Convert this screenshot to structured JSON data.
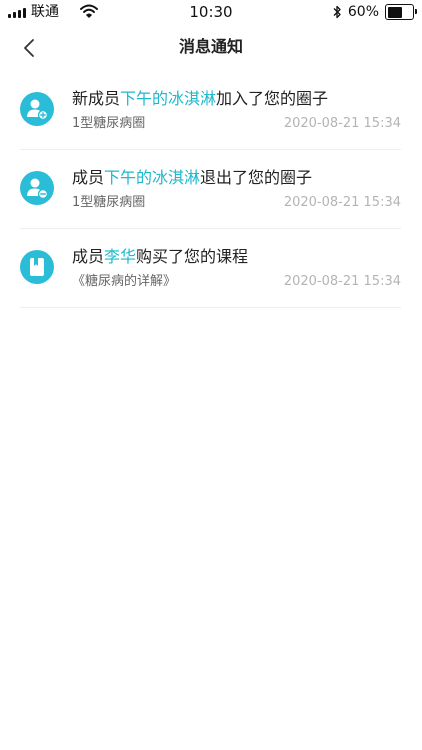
{
  "status_bar": {
    "carrier": "联通",
    "time": "10:30",
    "battery": "60%",
    "battery_level": 0.6
  },
  "nav": {
    "title": "消息通知"
  },
  "notifications": [
    {
      "icon": "user-add-icon",
      "title_prefix": "新成员",
      "title_highlight": "下午的冰淇淋",
      "title_suffix": "加入了您的圈子",
      "subtitle": "1型糖尿病圈",
      "time": "2020-08-21 15:34"
    },
    {
      "icon": "user-remove-icon",
      "title_prefix": "成员",
      "title_highlight": "下午的冰淇淋",
      "title_suffix": "退出了您的圈子",
      "subtitle": "1型糖尿病圈",
      "time": "2020-08-21 15:34"
    },
    {
      "icon": "book-icon",
      "title_prefix": "成员",
      "title_highlight": "李华",
      "title_suffix": "购买了您的课程",
      "subtitle": "《糖尿病的详解》",
      "time": "2020-08-21 15:34"
    }
  ],
  "colors": {
    "accent": "#1fb8cc",
    "icon_bg": "#2bbcd7"
  }
}
